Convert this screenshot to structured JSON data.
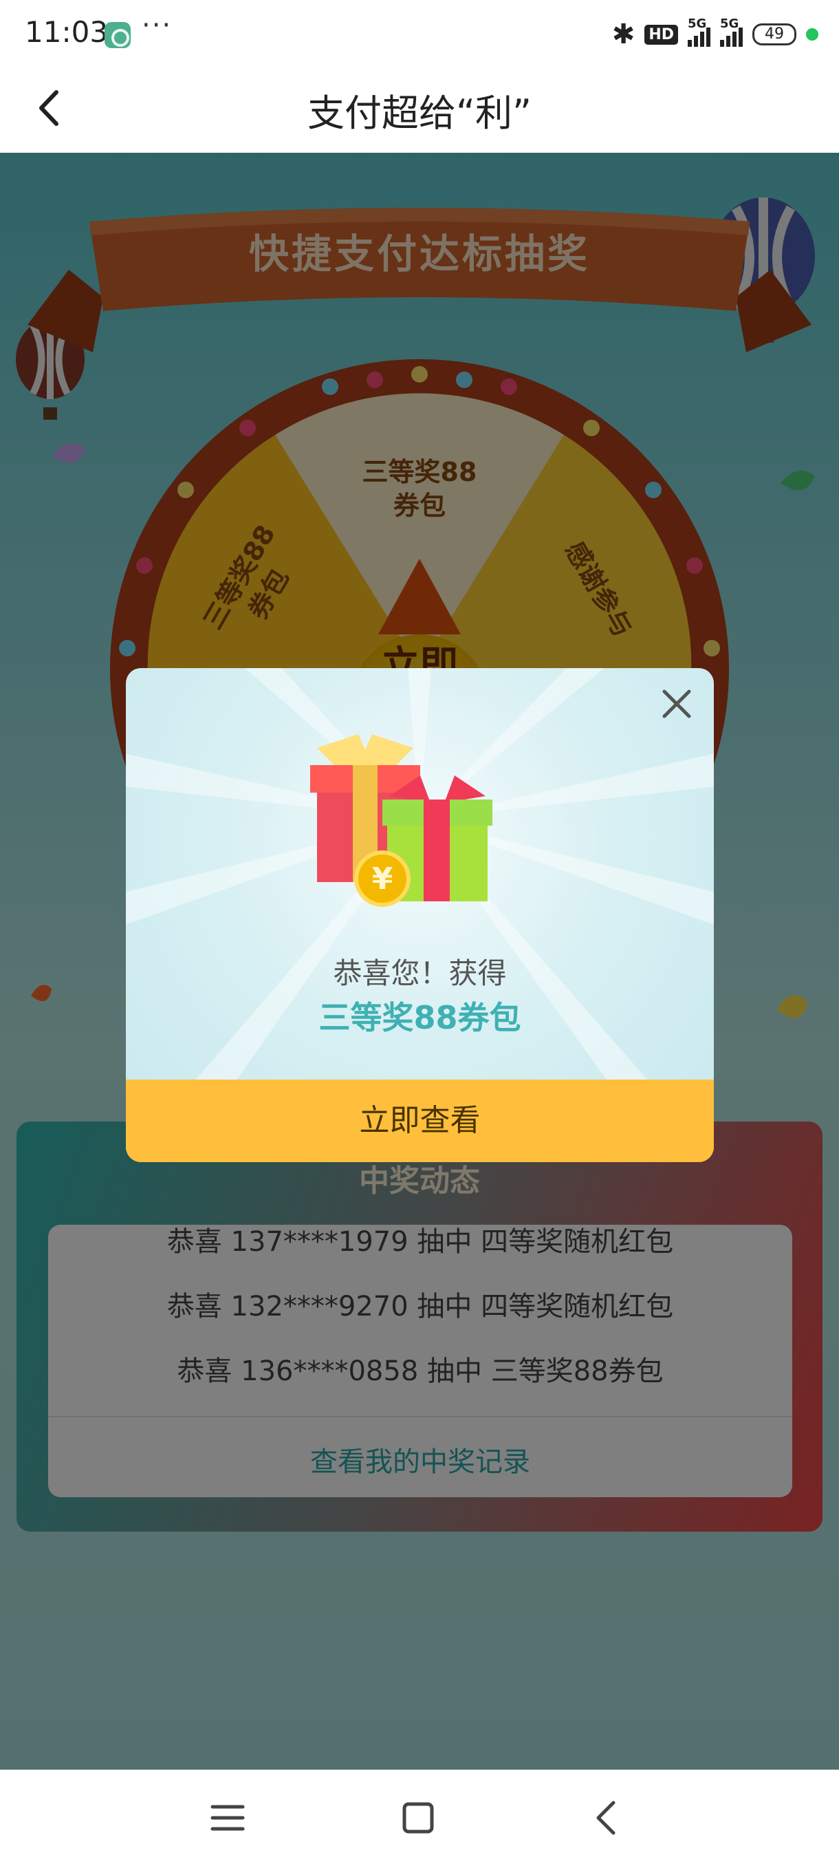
{
  "status_bar": {
    "time": "11:03",
    "more": "···",
    "hd": "HD",
    "signal1": "5G",
    "signal2": "5G",
    "battery": "49"
  },
  "nav": {
    "title": "支付超给“利”"
  },
  "banner": {
    "title": "快捷支付达标抽奖"
  },
  "wheel": {
    "segment_top": "三等奖88\n券包",
    "segment_left": "三等奖88\n券包",
    "segment_right": "感谢参与",
    "go_label": "立即"
  },
  "records": {
    "title": "中奖动态",
    "lines": [
      "恭喜 137****1979 抽中 四等奖随机红包",
      "恭喜 132****9270 抽中 四等奖随机红包",
      "恭喜 136****0858 抽中 三等奖88券包"
    ],
    "link": "查看我的中奖记录"
  },
  "modal": {
    "subtitle": "恭喜您！获得",
    "prize": "三等奖88券包",
    "button": "立即查看",
    "coin_symbol": "¥"
  },
  "icons": {
    "back": "chevron-left-icon",
    "close": "close-icon",
    "gift": "gift-icon",
    "menu": "menu-icon",
    "home": "square-home-icon",
    "sys_back": "triangle-back-icon"
  },
  "colors": {
    "accent": "#3fb0b3",
    "button": "#ffbf3c",
    "banner": "#c95a25"
  }
}
